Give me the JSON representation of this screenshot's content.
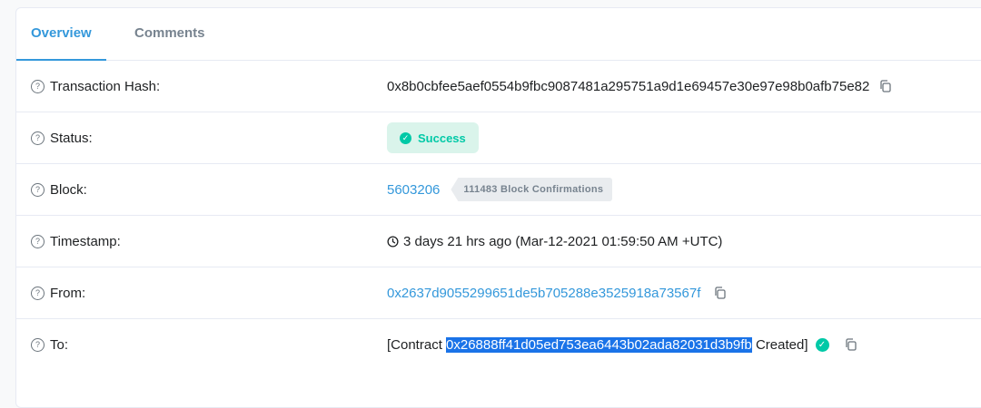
{
  "tabs": {
    "overview": "Overview",
    "comments": "Comments"
  },
  "rows": {
    "hash": {
      "label": "Transaction Hash:",
      "value": "0x8b0cbfee5aef0554b9fbc9087481a295751a9d1e69457e30e97e98b0afb75e82"
    },
    "status": {
      "label": "Status:",
      "value": "Success"
    },
    "block": {
      "label": "Block:",
      "number": "5603206",
      "confirmations": "111483 Block Confirmations"
    },
    "timestamp": {
      "label": "Timestamp:",
      "value": "3 days 21 hrs ago (Mar-12-2021 01:59:50 AM +UTC)"
    },
    "from": {
      "label": "From:",
      "value": "0x2637d9055299651de5b705288e3525918a73567f"
    },
    "to": {
      "label": "To:",
      "prefix": "[Contract",
      "address": "0x26888ff41d05ed753ea6443b02ada82031d3b9fb",
      "suffix": "Created]"
    }
  },
  "icons": {
    "help": "question-circle-icon",
    "copy": "copy-icon",
    "success": "check-circle-icon",
    "clock": "clock-icon"
  },
  "colors": {
    "link": "#3498db",
    "success": "#00c9a7",
    "success_bg": "#daf4eb",
    "selection": "#1a73e8"
  }
}
